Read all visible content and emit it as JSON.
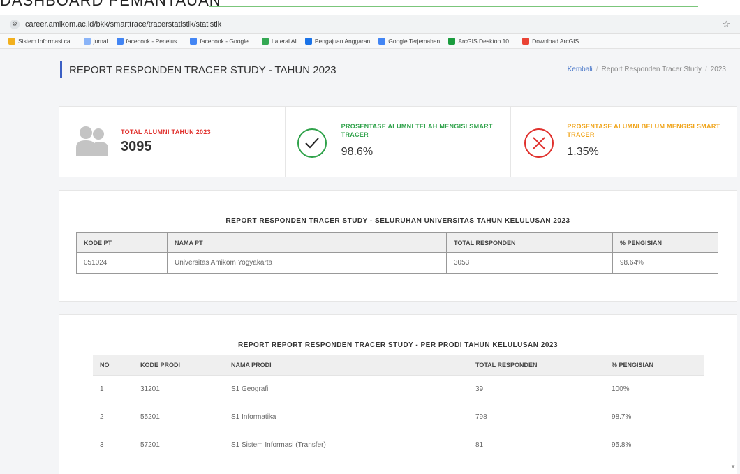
{
  "caption": "DASHBOARD PEMANTAUAN",
  "browser": {
    "url": "career.amikom.ac.id/bkk/smarttrace/tracerstatistik/statistik",
    "bookmarks": [
      {
        "label": "Sistem Informasi ca...",
        "color": "#f2b01e"
      },
      {
        "label": "jurnal",
        "color": "#8ab4f8"
      },
      {
        "label": "facebook - Penelus...",
        "color": "#4285f4"
      },
      {
        "label": "facebook - Google...",
        "color": "#4285f4"
      },
      {
        "label": "Lateral AI",
        "color": "#34a853"
      },
      {
        "label": "Pengajuan Anggaran",
        "color": "#1a73e8"
      },
      {
        "label": "Google Terjemahan",
        "color": "#4285f4"
      },
      {
        "label": "ArcGIS Desktop 10...",
        "color": "#1a9c3e"
      },
      {
        "label": "Download ArcGIS",
        "color": "#ea4335"
      }
    ]
  },
  "header": {
    "title": "REPORT RESPONDEN TRACER STUDY - TAHUN 2023",
    "breadcrumb": {
      "back": "Kembali",
      "current": "Report Responden Tracer Study",
      "year": "2023"
    }
  },
  "stats": [
    {
      "label": "TOTAL ALUMNI TAHUN 2023",
      "value": "3095",
      "color": "#e0312d"
    },
    {
      "label": "PROSENTASE ALUMNI TELAH MENGISI SMART TRACER",
      "value": "98.6%",
      "color": "#2fa24a"
    },
    {
      "label": "PROSENTASE ALUMNI BELUM MENGISI SMART TRACER",
      "value": "1.35%",
      "color": "#f0a51c"
    }
  ],
  "table_pt": {
    "title": "REPORT RESPONDEN TRACER STUDY - SELURUHAN UNIVERSITAS TAHUN KELULUSAN 2023",
    "headers": [
      "KODE PT",
      "NAMA PT",
      "TOTAL RESPONDEN",
      "% PENGISIAN"
    ],
    "rows": [
      [
        "051024",
        "Universitas Amikom Yogyakarta",
        "3053",
        "98.64%"
      ]
    ]
  },
  "table_prodi": {
    "title": "REPORT REPORT RESPONDEN TRACER STUDY - PER PRODI TAHUN KELULUSAN 2023",
    "headers": [
      "NO",
      "KODE PRODI",
      "NAMA PRODI",
      "TOTAL RESPONDEN",
      "% PENGISIAN"
    ],
    "rows": [
      [
        "1",
        "31201",
        "S1 Geografi",
        "39",
        "100%"
      ],
      [
        "2",
        "55201",
        "S1 Informatika",
        "798",
        "98.7%"
      ],
      [
        "3",
        "57201",
        "S1 Sistem Informasi (Transfer)",
        "81",
        "95.8%"
      ]
    ]
  }
}
